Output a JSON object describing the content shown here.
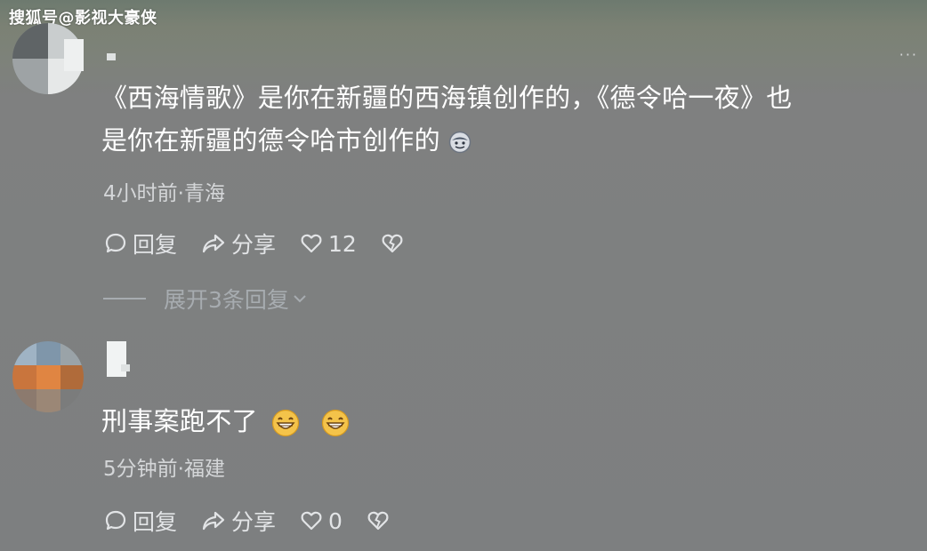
{
  "watermark": "搜狐号@影视大豪侠",
  "more_menu": "···",
  "comments": [
    {
      "line1": "《西海情歌》是你在新疆的西海镇创作的，《德令哈一夜》也",
      "line2": "是你在新疆的德令哈市创作的",
      "line2_emoji": "face-emoji",
      "meta": "4小时前·青海",
      "reply_label": "回复",
      "share_label": "分享",
      "like_count": "12",
      "expand_label": "展开3条回复"
    },
    {
      "text": "刑事案跑不了",
      "emojis": [
        "grin-emoji",
        "grin-emoji"
      ],
      "meta": "5分钟前·福建",
      "reply_label": "回复",
      "share_label": "分享",
      "like_count": "0"
    }
  ],
  "icons": {
    "reply": "comment-bubble-icon",
    "share": "share-arrow-icon",
    "like": "heart-icon",
    "dislike": "broken-heart-icon",
    "expand": "chevron-down-icon"
  }
}
